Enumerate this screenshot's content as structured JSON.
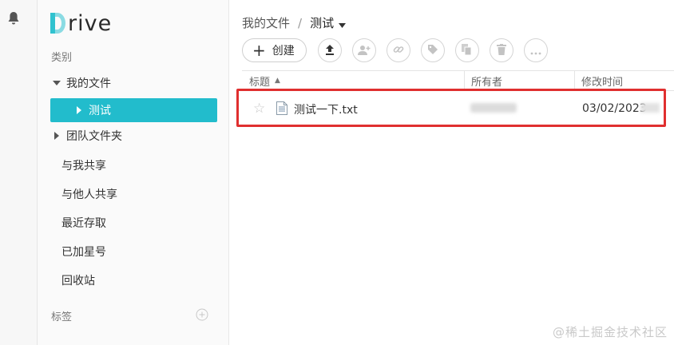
{
  "app": {
    "logo_letter": "D",
    "logo_rest": "rive"
  },
  "sidebar": {
    "category_label": "类别",
    "items": [
      {
        "label": "我的文件"
      },
      {
        "label": "测试"
      },
      {
        "label": "团队文件夹"
      },
      {
        "label": "与我共享"
      },
      {
        "label": "与他人共享"
      },
      {
        "label": "最近存取"
      },
      {
        "label": "已加星号"
      },
      {
        "label": "回收站"
      }
    ],
    "tags_label": "标签"
  },
  "breadcrumb": {
    "root": "我的文件",
    "separator": "/",
    "current": "测试"
  },
  "toolbar": {
    "create_label": "创建",
    "icons": [
      "upload-icon",
      "share-user-icon",
      "link-icon",
      "tag-icon",
      "copy-icon",
      "trash-icon",
      "more-icon"
    ]
  },
  "table": {
    "columns": {
      "title": "标题",
      "owner": "所有者",
      "modified": "修改时间"
    },
    "rows": [
      {
        "name": "测试一下.txt",
        "date": "03/02/2023"
      }
    ]
  },
  "colors": {
    "accent": "#22bccc",
    "highlight_border": "#e02f2f"
  },
  "watermark": "@稀土掘金技术社区"
}
